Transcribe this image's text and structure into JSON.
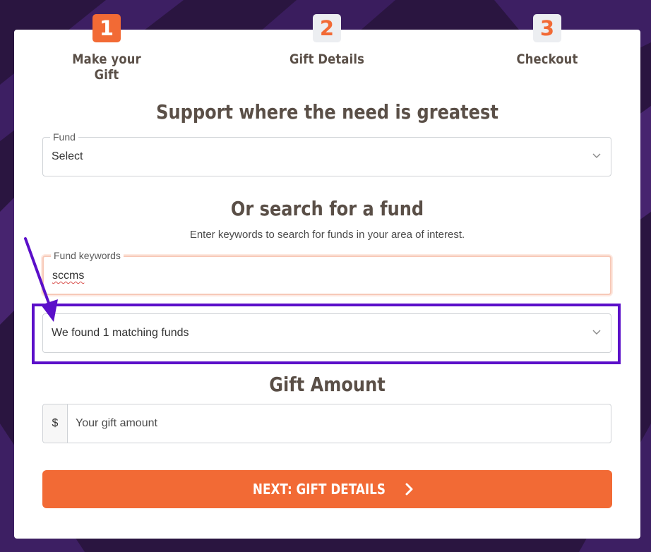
{
  "steps": [
    {
      "number": "1",
      "label": "Make your Gift",
      "active": true
    },
    {
      "number": "2",
      "label": "Gift Details",
      "active": false
    },
    {
      "number": "3",
      "label": "Checkout",
      "active": false
    }
  ],
  "support_heading": "Support where the need is greatest",
  "fund_select": {
    "legend": "Fund",
    "value": "Select"
  },
  "search_heading": "Or search for a fund",
  "search_help": "Enter keywords to search for funds in your area of interest.",
  "keywords_field": {
    "legend": "Fund keywords",
    "value": "sccms"
  },
  "results_select": {
    "value": "We found 1 matching funds"
  },
  "gift_heading": "Gift Amount",
  "amount": {
    "prefix": "$",
    "placeholder": "Your gift amount"
  },
  "next_button": {
    "label": "NEXT: GIFT DETAILS"
  },
  "colors": {
    "accent": "#f26a35",
    "annotation": "#5b0fc9",
    "background": "#2a1540"
  },
  "icons": {
    "select_chevron": "chevron-down-icon",
    "next_arrow": "chevron-right-icon",
    "annotation": "arrow-annotation"
  }
}
